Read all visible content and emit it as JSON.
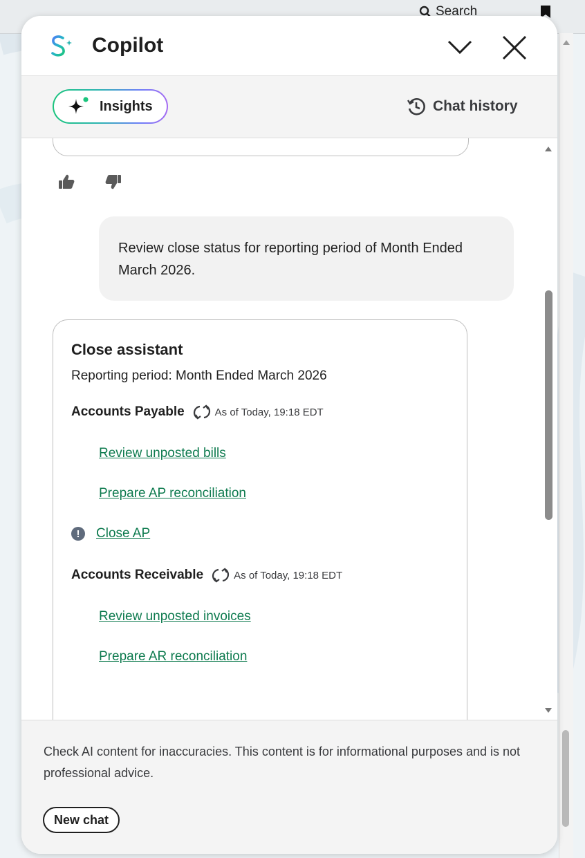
{
  "page": {
    "search_label": "Search"
  },
  "copilot": {
    "title": "Copilot",
    "insights_label": "Insights",
    "chat_history_label": "Chat history",
    "user_message": "Review close status for reporting period of Month Ended March 2026.",
    "assistant": {
      "title": "Close assistant",
      "period": "Reporting period: Month Ended March 2026",
      "sections": [
        {
          "heading": "Accounts Payable",
          "as_of": "As of Today, 19:18 EDT",
          "tasks": [
            "Review unposted bills",
            "Prepare AP reconciliation"
          ],
          "warning_task": "Close AP"
        },
        {
          "heading": "Accounts Receivable",
          "as_of": "As of Today, 19:18 EDT",
          "tasks": [
            "Review unposted invoices",
            "Prepare AR reconciliation"
          ]
        }
      ]
    },
    "disclaimer": "Check AI content for inaccuracies. This content is for informational purposes and is not professional advice.",
    "new_chat_label": "New chat"
  },
  "colors": {
    "link": "#0d7a4e",
    "insights_gradient": [
      "#1bc47d",
      "#6b7ef7",
      "#a66bf2"
    ]
  },
  "icons": [
    "search-icon",
    "bookmark-icon",
    "copilot-logo-icon",
    "chevron-down-icon",
    "close-icon",
    "sparkle-icon",
    "history-clock-icon",
    "thumbs-up-icon",
    "thumbs-down-icon",
    "refresh-icon",
    "warning-icon"
  ]
}
